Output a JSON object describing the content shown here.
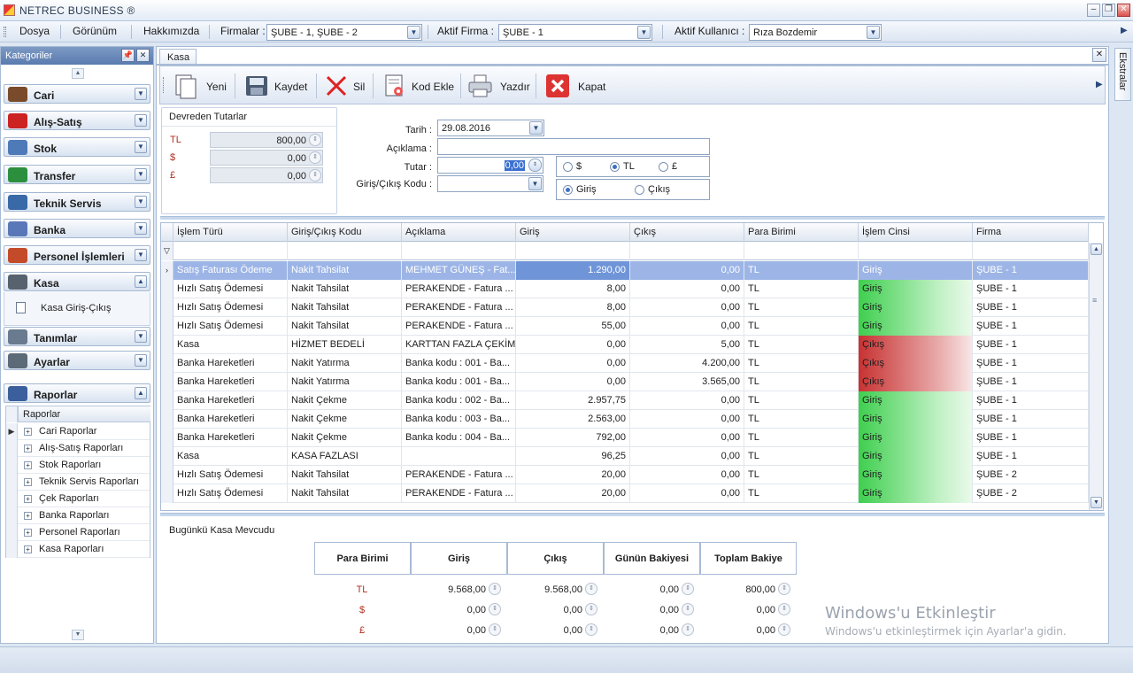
{
  "window": {
    "title": "NETREC BUSINESS ®"
  },
  "menu": {
    "dosya": "Dosya",
    "gorunum": "Görünüm",
    "hakkimizda": "Hakkımızda",
    "firmalar_label": "Firmalar :",
    "firmalar_value": "ŞUBE - 1, ŞUBE - 2",
    "aktif_firma_label": "Aktif Firma :",
    "aktif_firma_value": "ŞUBE - 1",
    "aktif_kullanici_label": "Aktif Kullanıcı :",
    "aktif_kullanici_value": "Rıza Bozdemir"
  },
  "sidebar": {
    "title": "Kategoriler",
    "categories": [
      {
        "label": "Cari",
        "icon": "person-icon",
        "color": "#7a4b2a"
      },
      {
        "label": "Alış-Satış",
        "icon": "shopping-bag-icon",
        "color": "#cc2222"
      },
      {
        "label": "Stok",
        "icon": "box-icon",
        "color": "#4f7ab8"
      },
      {
        "label": "Transfer",
        "icon": "transfer-icon",
        "color": "#2c8f3e"
      },
      {
        "label": "Teknik Servis",
        "icon": "toolbox-icon",
        "color": "#3a69a8"
      },
      {
        "label": "Banka",
        "icon": "bank-icon",
        "color": "#5a78b8"
      },
      {
        "label": "Personel İşlemleri",
        "icon": "people-icon",
        "color": "#c44b2a"
      },
      {
        "label": "Kasa",
        "icon": "cashbox-icon",
        "color": "#58626e"
      },
      {
        "label": "Tanımlar",
        "icon": "list-icon",
        "color": "#6a7a8f"
      },
      {
        "label": "Ayarlar",
        "icon": "wrench-icon",
        "color": "#5d6a78"
      },
      {
        "label": "Raporlar",
        "icon": "chart-icon",
        "color": "#3a5f9c"
      }
    ],
    "kasa_item": "Kasa Giriş-Çıkış",
    "reports_header": "Raporlar",
    "reports": [
      "Cari Raporlar",
      "Alış-Satış Raporları",
      "Stok Raporları",
      "Teknik Servis Raporları",
      "Çek Raporları",
      "Banka Raporları",
      "Personel Raporları",
      "Kasa Raporları"
    ]
  },
  "tab": {
    "label": "Kasa"
  },
  "toolbar": {
    "yeni": "Yeni",
    "kaydet": "Kaydet",
    "sil": "Sil",
    "kod_ekle": "Kod Ekle",
    "yazdir": "Yazdır",
    "kapat": "Kapat"
  },
  "devreden": {
    "title": "Devreden Tutarlar",
    "rows": [
      {
        "cur": "TL",
        "val": "800,00"
      },
      {
        "cur": "$",
        "val": "0,00"
      },
      {
        "cur": "£",
        "val": "0,00"
      }
    ]
  },
  "form": {
    "tarih_label": "Tarih :",
    "tarih_value": "29.08.2016",
    "aciklama_label": "Açıklama :",
    "aciklama_value": "",
    "tutar_label": "Tutar :",
    "tutar_value": "0,00",
    "kod_label": "Giriş/Çıkış Kodu :",
    "kod_value": "",
    "cur_usd": "$",
    "cur_tl": "TL",
    "cur_gbp": "£",
    "giris": "Giriş",
    "cikis": "Çıkış"
  },
  "grid": {
    "columns": [
      "İşlem Türü",
      "Giriş/Çıkış Kodu",
      "Açıklama",
      "Giriş",
      "Çıkış",
      "Para Birimi",
      "İşlem Cinsi",
      "Firma"
    ],
    "rows": [
      [
        "Satış Faturası Ödeme",
        "Nakit Tahsilat",
        "MEHMET GÜNEŞ -  Fat...",
        "1.290,00",
        "0,00",
        "TL",
        "Giriş",
        "ŞUBE - 1"
      ],
      [
        "Hızlı Satış Ödemesi",
        "Nakit Tahsilat",
        "PERAKENDE -  Fatura ...",
        "8,00",
        "0,00",
        "TL",
        "Giriş",
        "ŞUBE - 1"
      ],
      [
        "Hızlı Satış Ödemesi",
        "Nakit Tahsilat",
        "PERAKENDE -  Fatura ...",
        "8,00",
        "0,00",
        "TL",
        "Giriş",
        "ŞUBE - 1"
      ],
      [
        "Hızlı Satış Ödemesi",
        "Nakit Tahsilat",
        "PERAKENDE -  Fatura ...",
        "55,00",
        "0,00",
        "TL",
        "Giriş",
        "ŞUBE - 1"
      ],
      [
        "Kasa",
        "HİZMET BEDELİ",
        "KARTTAN FAZLA ÇEKİM",
        "0,00",
        "5,00",
        "TL",
        "Çıkış",
        "ŞUBE - 1"
      ],
      [
        "Banka Hareketleri",
        "Nakit Yatırma",
        "Banka kodu : 001 - Ba...",
        "0,00",
        "4.200,00",
        "TL",
        "Çıkış",
        "ŞUBE - 1"
      ],
      [
        "Banka Hareketleri",
        "Nakit Yatırma",
        "Banka kodu : 001 - Ba...",
        "0,00",
        "3.565,00",
        "TL",
        "Çıkış",
        "ŞUBE - 1"
      ],
      [
        "Banka Hareketleri",
        "Nakit Çekme",
        "Banka kodu : 002 - Ba...",
        "2.957,75",
        "0,00",
        "TL",
        "Giriş",
        "ŞUBE - 1"
      ],
      [
        "Banka Hareketleri",
        "Nakit Çekme",
        "Banka kodu : 003 - Ba...",
        "2.563,00",
        "0,00",
        "TL",
        "Giriş",
        "ŞUBE - 1"
      ],
      [
        "Banka Hareketleri",
        "Nakit Çekme",
        "Banka kodu : 004 - Ba...",
        "792,00",
        "0,00",
        "TL",
        "Giriş",
        "ŞUBE - 1"
      ],
      [
        "Kasa",
        "KASA FAZLASI",
        "",
        "96,25",
        "0,00",
        "TL",
        "Giriş",
        "ŞUBE - 1"
      ],
      [
        "Hızlı Satış Ödemesi",
        "Nakit Tahsilat",
        "PERAKENDE -  Fatura ...",
        "20,00",
        "0,00",
        "TL",
        "Giriş",
        "ŞUBE - 2"
      ],
      [
        "Hızlı Satış Ödemesi",
        "Nakit Tahsilat",
        "PERAKENDE -  Fatura ...",
        "20,00",
        "0,00",
        "TL",
        "Giriş",
        "ŞUBE - 2"
      ]
    ]
  },
  "bottom": {
    "title": "Bugünkü Kasa Mevcudu",
    "headers": [
      "Para Birimi",
      "Giriş",
      "Çıkış",
      "Günün Bakiyesi",
      "Toplam Bakiye"
    ],
    "rows": [
      {
        "cur": "TL",
        "giris": "9.568,00",
        "cikis": "9.568,00",
        "gunun": "0,00",
        "toplam": "800,00"
      },
      {
        "cur": "$",
        "giris": "0,00",
        "cikis": "0,00",
        "gunun": "0,00",
        "toplam": "0,00"
      },
      {
        "cur": "£",
        "giris": "0,00",
        "cikis": "0,00",
        "gunun": "0,00",
        "toplam": "0,00"
      }
    ]
  },
  "rightbar": {
    "ekstralar": "Ekstralar"
  },
  "watermark": {
    "line1": "Windows'u Etkinleştir",
    "line2": "Windows'u etkinleştirmek için Ayarlar'a gidin."
  },
  "colors": {
    "giris": "#3fcf4f",
    "cikis": "#c83232",
    "selection": "#9db5e6"
  }
}
